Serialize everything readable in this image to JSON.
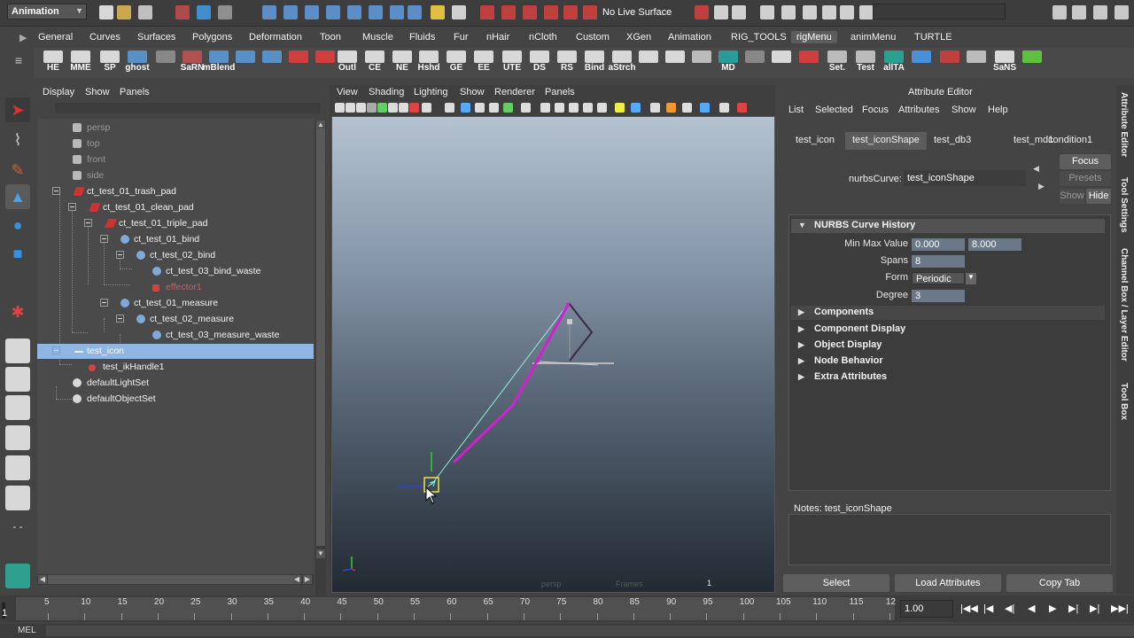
{
  "status_line": {
    "mode": "Animation",
    "no_live_surface": "No Live Surface"
  },
  "shelf_tabs": [
    "General",
    "Curves",
    "Surfaces",
    "Polygons",
    "Deformation",
    "Toon",
    "Muscle",
    "Fluids",
    "Fur",
    "nHair",
    "nCloth",
    "Custom",
    "XGen",
    "Animation",
    "RIG_TOOLS",
    "rigMenu",
    "animMenu",
    "TURTLE"
  ],
  "shelf_active": "rigMenu",
  "shelf_buttons": [
    "HE",
    "MME",
    "SP",
    "ghost",
    "",
    "SaRN",
    "mBlend",
    "",
    "",
    "",
    "",
    "Outl",
    "CE",
    "NE",
    "Hshd",
    "GE",
    "EE",
    "UTE",
    "DS",
    "RS",
    "Bind",
    "aStrch",
    "",
    "",
    "",
    "MD",
    "",
    "",
    "",
    "Set.",
    "Test",
    "allTA",
    "",
    "",
    "",
    "SaNS",
    ""
  ],
  "outliner": {
    "menu": [
      "Display",
      "Show",
      "Panels"
    ],
    "items": [
      {
        "label": "persp"
      },
      {
        "label": "top"
      },
      {
        "label": "front"
      },
      {
        "label": "side"
      },
      {
        "label": "ct_test_01_trash_pad"
      },
      {
        "label": "ct_test_01_clean_pad"
      },
      {
        "label": "ct_test_01_triple_pad"
      },
      {
        "label": "ct_test_01_bind"
      },
      {
        "label": "ct_test_02_bind"
      },
      {
        "label": "ct_test_03_bind_waste"
      },
      {
        "label": "effector1"
      },
      {
        "label": "ct_test_01_measure"
      },
      {
        "label": "ct_test_02_measure"
      },
      {
        "label": "ct_test_03_measure_waste"
      },
      {
        "label": "test_icon"
      },
      {
        "label": "test_ikHandle1"
      },
      {
        "label": "defaultLightSet"
      },
      {
        "label": "defaultObjectSet"
      }
    ]
  },
  "viewport": {
    "menu": [
      "View",
      "Shading",
      "Lighting",
      "Show",
      "Renderer",
      "Panels"
    ],
    "camera_label": "persp",
    "frames_label": "Frames",
    "frame_number": "1"
  },
  "attribute_editor": {
    "title": "Attribute Editor",
    "menu": [
      "List",
      "Selected",
      "Focus",
      "Attributes",
      "Show",
      "Help"
    ],
    "tabs": [
      "test_icon",
      "test_iconShape",
      "test_db3",
      "test_md1",
      "condition1"
    ],
    "active_tab": "test_iconShape",
    "nurbs_curve_label": "nurbsCurve:",
    "nurbs_curve_value": "test_iconShape",
    "focus": "Focus",
    "presets": "Presets",
    "show": "Show",
    "hide": "Hide",
    "history_section": "NURBS Curve History",
    "min_max_label": "Min Max Value",
    "min_value": "0.000",
    "max_value": "8.000",
    "spans_label": "Spans",
    "spans_value": "8",
    "form_label": "Form",
    "form_value": "Periodic",
    "degree_label": "Degree",
    "degree_value": "3",
    "sections": [
      "Components",
      "Component Display",
      "Object Display",
      "Node Behavior",
      "Extra Attributes"
    ],
    "notes_label": "Notes:  test_iconShape",
    "buttons": [
      "Select",
      "Load Attributes",
      "Copy Tab"
    ]
  },
  "side_tabs": [
    "Attribute Editor",
    "Tool Settings",
    "Channel Box / Layer Editor",
    "Tool Box"
  ],
  "time_slider": {
    "ticks": [
      "5",
      "10",
      "15",
      "20",
      "25",
      "30",
      "35",
      "40",
      "45",
      "50",
      "55",
      "60",
      "65",
      "70",
      "75",
      "80",
      "85",
      "90",
      "95",
      "100",
      "105",
      "110",
      "115",
      "12"
    ],
    "current": "1",
    "current_time": "1.00"
  },
  "command_line": {
    "label": "MEL"
  }
}
